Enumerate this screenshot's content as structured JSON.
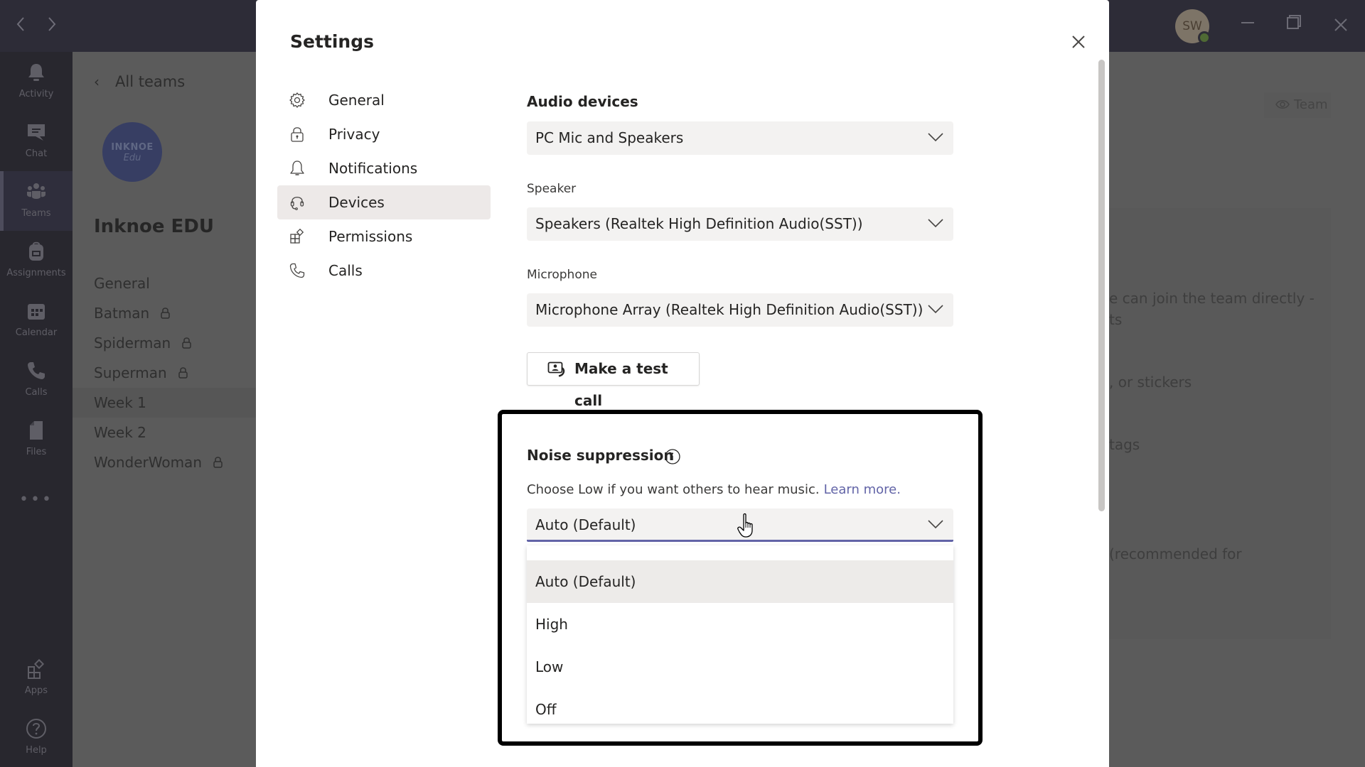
{
  "window": {
    "back_icon": "chevron-left-icon",
    "forward_icon": "chevron-right-icon",
    "avatar_initials": "SW",
    "presence_status": "available",
    "controls": [
      "minimize",
      "restore",
      "close"
    ]
  },
  "rail": {
    "items": [
      {
        "label": "Activity",
        "icon": "bell-icon"
      },
      {
        "label": "Chat",
        "icon": "chat-icon"
      },
      {
        "label": "Teams",
        "icon": "teams-icon",
        "active": true
      },
      {
        "label": "Assignments",
        "icon": "backpack-icon"
      },
      {
        "label": "Calendar",
        "icon": "calendar-icon"
      },
      {
        "label": "Calls",
        "icon": "phone-icon"
      },
      {
        "label": "Files",
        "icon": "file-icon"
      }
    ],
    "more": "•••",
    "bottom_items": [
      {
        "label": "Apps",
        "icon": "apps-icon"
      },
      {
        "label": "Help",
        "icon": "help-icon"
      }
    ]
  },
  "team_panel": {
    "back_label": "All teams",
    "logo_line1": "INKNOE",
    "logo_line2": "Edu",
    "team_name": "Inknoe EDU",
    "channels": [
      {
        "name": "General",
        "private": false
      },
      {
        "name": "Batman",
        "private": true
      },
      {
        "name": "Spiderman",
        "private": true
      },
      {
        "name": "Superman",
        "private": true
      },
      {
        "name": "Week 1",
        "private": false,
        "active": true
      },
      {
        "name": "Week 2",
        "private": false
      },
      {
        "name": "WonderWoman",
        "private": true
      }
    ]
  },
  "background_content": {
    "team_chip": "Team",
    "lines": [
      "e can join the team directly -",
      "ts",
      ", or stickers",
      "tags",
      "(recommended for"
    ]
  },
  "settings": {
    "title": "Settings",
    "nav": [
      {
        "label": "General",
        "icon": "gear-icon"
      },
      {
        "label": "Privacy",
        "icon": "lock-icon"
      },
      {
        "label": "Notifications",
        "icon": "bell-icon"
      },
      {
        "label": "Devices",
        "icon": "headset-icon",
        "active": true
      },
      {
        "label": "Permissions",
        "icon": "apps-icon"
      },
      {
        "label": "Calls",
        "icon": "phone-icon"
      }
    ],
    "devices": {
      "audio_devices_label": "Audio devices",
      "audio_devices_value": "PC Mic and Speakers",
      "speaker_label": "Speaker",
      "speaker_value": "Speakers (Realtek High Definition Audio(SST))",
      "microphone_label": "Microphone",
      "microphone_value": "Microphone Array (Realtek High Definition Audio(SST))",
      "test_call_label": "Make a test call",
      "noise_suppression": {
        "title": "Noise suppression",
        "help_text": "Choose Low if you want others to hear music.",
        "learn_more": "Learn more.",
        "selected": "Auto (Default)",
        "options": [
          "Auto (Default)",
          "High",
          "Low",
          "Off"
        ],
        "hovered_option": "Auto (Default)"
      }
    }
  },
  "colors": {
    "accent": "#6264a7",
    "highlight_border": "#000000"
  }
}
